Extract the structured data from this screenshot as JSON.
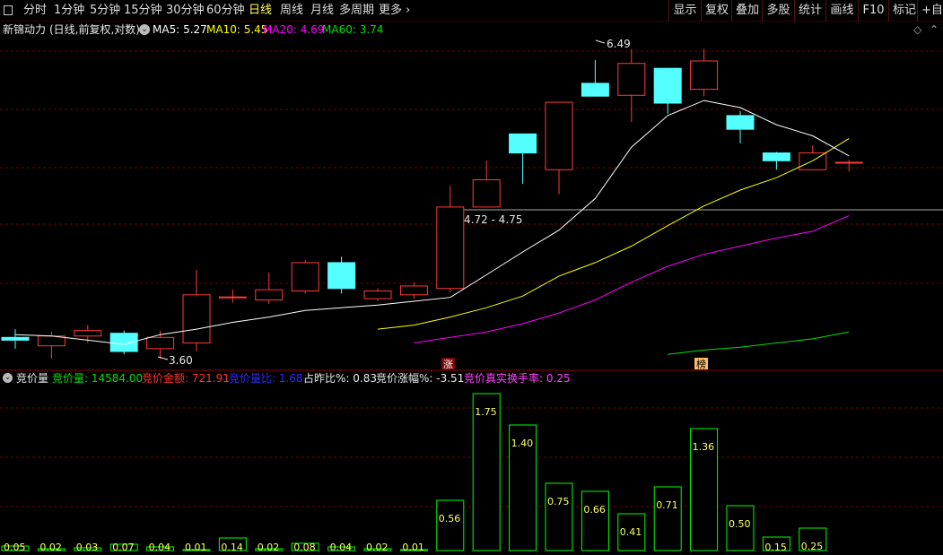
{
  "toolbar": {
    "periods": [
      {
        "label": "分时",
        "active": false
      },
      {
        "label": "1分钟",
        "active": false
      },
      {
        "label": "5分钟",
        "active": false
      },
      {
        "label": "15分钟",
        "active": false
      },
      {
        "label": "30分钟",
        "active": false
      },
      {
        "label": "60分钟",
        "active": false
      },
      {
        "label": "日线",
        "active": true
      },
      {
        "label": "周线",
        "active": false
      },
      {
        "label": "月线",
        "active": false
      },
      {
        "label": "多周期",
        "active": false
      },
      {
        "label": "更多 ›",
        "active": false
      }
    ],
    "right_buttons": [
      "显示",
      "复权",
      "叠加",
      "多股",
      "统计",
      "画线",
      "F10",
      "标记",
      "+自选"
    ]
  },
  "main_info": {
    "stock_name": "新锦动力",
    "mode": "(日线,前复权,对数)",
    "ma5_label": "MA5:",
    "ma5": "5.27",
    "ma10_label": "MA10:",
    "ma10": "5.45",
    "ma20_label": "MA20:",
    "ma20": "4.69",
    "ma60_label": "MA60:",
    "ma60": "3.74"
  },
  "sub_info": {
    "indicator": "竞价量",
    "vol_label": "竞价量:",
    "vol": "14584.00",
    "amount_label": "竞价金额:",
    "amount": "721.91",
    "ratio_label": "竞价量比:",
    "ratio": "1.68",
    "prev_label": "占昨比%:",
    "prev": "0.83",
    "chg_label": "竞价涨幅%:",
    "chg": "-3.51",
    "turnover_label": "竞价真实换手率:",
    "turnover": "0.25"
  },
  "annotations": {
    "high_label": "6.49",
    "low_label": "3.60",
    "range_label": "4.72 - 4.75",
    "zhang": "涨",
    "bang": "榜"
  },
  "colors": {
    "up": "#ff3a3a",
    "down": "#54ffff",
    "grid": "#7a0000",
    "ma5": "#ffffff",
    "ma10": "#ffff00",
    "ma20": "#ff00ff",
    "ma60": "#00e000",
    "vol_bar": "#00ff00",
    "vol_label": "#ffff66"
  },
  "chart_data": {
    "type": "candlestick",
    "candles": [
      {
        "open": 3.7,
        "close": 3.68,
        "high": 3.76,
        "low": 3.62
      },
      {
        "open": 3.64,
        "close": 3.71,
        "high": 3.74,
        "low": 3.55
      },
      {
        "open": 3.71,
        "close": 3.75,
        "high": 3.79,
        "low": 3.66
      },
      {
        "open": 3.73,
        "close": 3.6,
        "high": 3.75,
        "low": 3.58
      },
      {
        "open": 3.62,
        "close": 3.7,
        "high": 3.75,
        "low": 3.55
      },
      {
        "open": 3.66,
        "close": 4.02,
        "high": 4.22,
        "low": 3.6
      },
      {
        "open": 4.0,
        "close": 4.0,
        "high": 4.06,
        "low": 3.96
      },
      {
        "open": 3.98,
        "close": 4.06,
        "high": 4.2,
        "low": 3.95
      },
      {
        "open": 4.05,
        "close": 4.28,
        "high": 4.3,
        "low": 4.03
      },
      {
        "open": 4.28,
        "close": 4.07,
        "high": 4.33,
        "low": 4.03
      },
      {
        "open": 3.99,
        "close": 4.05,
        "high": 4.07,
        "low": 3.97
      },
      {
        "open": 4.02,
        "close": 4.09,
        "high": 4.12,
        "low": 3.99
      },
      {
        "open": 4.07,
        "close": 4.77,
        "high": 4.97,
        "low": 4.04
      },
      {
        "open": 4.77,
        "close": 5.03,
        "high": 5.22,
        "low": 4.77
      },
      {
        "open": 5.5,
        "close": 5.3,
        "high": 5.45,
        "low": 4.99
      },
      {
        "open": 5.13,
        "close": 5.85,
        "high": 5.85,
        "low": 4.89
      },
      {
        "open": 6.07,
        "close": 5.92,
        "high": 6.35,
        "low": 5.92
      },
      {
        "open": 5.93,
        "close": 6.31,
        "high": 6.49,
        "low": 5.63
      },
      {
        "open": 6.25,
        "close": 5.84,
        "high": 6.2,
        "low": 5.72
      },
      {
        "open": 6.0,
        "close": 6.34,
        "high": 6.49,
        "low": 5.92
      },
      {
        "open": 5.7,
        "close": 5.55,
        "high": 5.75,
        "low": 5.4
      },
      {
        "open": 5.3,
        "close": 5.22,
        "high": 5.31,
        "low": 5.13
      },
      {
        "open": 5.13,
        "close": 5.3,
        "high": 5.38,
        "low": 5.13
      },
      {
        "open": 5.2,
        "close": 5.2,
        "high": 5.23,
        "low": 5.11
      }
    ],
    "ma5": [
      3.72,
      3.71,
      3.68,
      3.65,
      3.72,
      3.76,
      3.81,
      3.85,
      3.9,
      3.92,
      3.94,
      3.97,
      4.0,
      4.18,
      4.37,
      4.56,
      4.85,
      5.36,
      5.7,
      5.87,
      5.79,
      5.6,
      5.48,
      5.27
    ],
    "ma10": [
      null,
      null,
      null,
      null,
      null,
      null,
      null,
      null,
      null,
      null,
      3.76,
      3.79,
      3.85,
      3.92,
      4.01,
      4.17,
      4.28,
      4.42,
      4.6,
      4.78,
      4.93,
      5.05,
      5.22,
      5.45
    ],
    "ma20": [
      null,
      null,
      null,
      null,
      null,
      null,
      null,
      null,
      null,
      null,
      null,
      3.66,
      3.7,
      3.74,
      3.8,
      3.88,
      3.98,
      4.12,
      4.25,
      4.35,
      4.42,
      4.49,
      4.55,
      4.69
    ],
    "ma60": [
      null,
      null,
      null,
      null,
      null,
      null,
      null,
      null,
      null,
      null,
      null,
      null,
      null,
      null,
      null,
      null,
      null,
      null,
      3.58,
      3.61,
      3.63,
      3.66,
      3.69,
      3.74
    ],
    "auction_volume_ratio": [
      0.05,
      0.02,
      0.03,
      0.07,
      0.04,
      0.01,
      0.14,
      0.02,
      0.08,
      0.04,
      0.02,
      0.01,
      0.56,
      1.75,
      1.4,
      0.75,
      0.66,
      0.41,
      0.71,
      1.36,
      0.5,
      0.15,
      0.25
    ],
    "price_range": [
      3.55,
      6.6
    ]
  }
}
